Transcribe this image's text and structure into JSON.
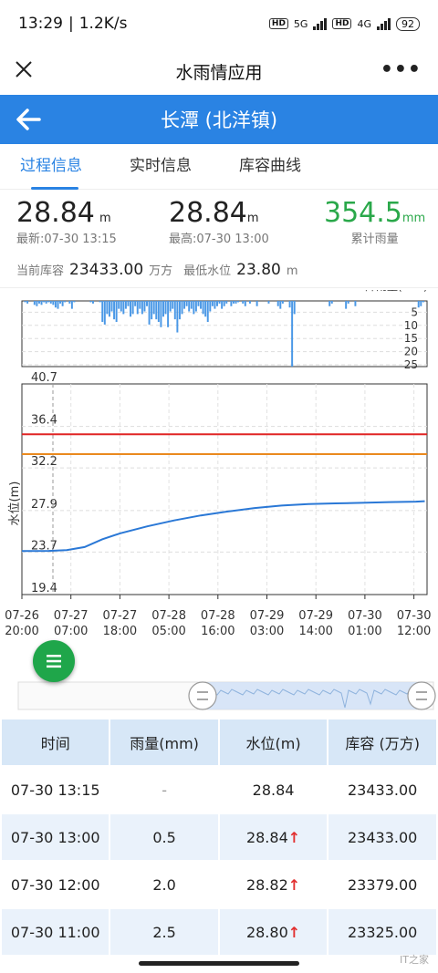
{
  "status_bar": {
    "time": "13:29",
    "speed": "1.2K/s",
    "net1": "5G",
    "net2": "4G",
    "battery": "92"
  },
  "app": {
    "title": "水雨情应用"
  },
  "header": {
    "station": "长潭 (北洋镇)"
  },
  "tabs": [
    {
      "label": "过程信息",
      "active": true
    },
    {
      "label": "实时信息",
      "active": false
    },
    {
      "label": "库容曲线",
      "active": false
    }
  ],
  "stats": {
    "latest_value": "28.84",
    "latest_unit": "m",
    "latest_label": "最新:07-30 13:15",
    "max_value": "28.84",
    "max_unit": "m",
    "max_label": "最高:07-30 13:00",
    "rain_value": "354.5",
    "rain_unit": "mm",
    "rain_label": "累计雨量",
    "storage_label": "当前库容",
    "storage_value": "23433.00",
    "storage_unit": "万方",
    "min_label": "最低水位",
    "min_value": "23.80",
    "min_unit": "m"
  },
  "chart_data": [
    {
      "type": "bar",
      "title": "",
      "ylabel": "降雨量(mm)",
      "ylim": [
        0,
        25
      ],
      "yticks": [
        "5",
        "10",
        "15",
        "20",
        "25"
      ],
      "values": [
        0,
        0.5,
        1,
        0,
        0,
        1.5,
        2,
        1,
        1.5,
        0.5,
        1,
        0.5,
        1,
        1.5,
        2.5,
        3,
        1,
        2,
        0.5,
        0,
        1,
        3,
        0.5,
        0,
        0,
        0,
        0,
        0,
        0,
        0.5,
        1,
        0,
        0,
        0.5,
        8,
        9,
        5,
        6,
        4,
        7,
        8,
        3,
        4,
        5,
        3,
        2,
        6,
        5,
        2,
        5,
        3,
        5,
        4,
        2,
        9,
        7,
        5,
        7,
        8,
        10,
        6,
        5,
        10,
        4,
        3,
        7,
        12,
        7,
        5,
        3,
        2,
        4,
        3,
        5,
        4,
        2,
        3,
        5,
        6,
        8,
        4,
        2,
        3,
        2,
        1,
        3,
        2,
        1,
        0,
        2,
        1,
        1,
        0.5,
        0,
        1,
        2,
        0,
        1,
        0,
        0,
        2,
        0,
        0,
        0,
        0,
        1,
        0,
        0,
        0,
        2,
        3,
        1,
        0,
        0,
        2.5,
        25,
        5,
        0,
        0,
        0,
        0,
        0,
        0,
        0,
        0,
        0,
        0,
        0,
        0,
        0,
        0,
        2,
        1,
        0,
        0,
        0,
        0,
        0,
        3,
        1,
        0,
        0,
        2,
        0,
        0,
        0,
        0,
        0,
        0,
        0,
        0,
        0,
        0,
        0,
        0,
        0,
        0,
        0,
        0,
        0,
        0,
        0,
        0,
        0,
        0,
        0,
        0,
        0,
        0,
        2.5,
        2.0,
        0.5,
        0
      ]
    },
    {
      "type": "line",
      "title": "",
      "ylabel": "水位(m)",
      "ylim": [
        19.4,
        40.7
      ],
      "yticks": [
        "40.7",
        "36.4",
        "32.2",
        "27.9",
        "23.7",
        "19.4"
      ],
      "xticks": [
        "07-26\n20:00",
        "07-27\n07:00",
        "07-27\n18:00",
        "07-28\n05:00",
        "07-28\n16:00",
        "07-29\n03:00",
        "07-29\n14:00",
        "07-30\n01:00",
        "07-30\n12:00"
      ],
      "thresholds": [
        {
          "value": 35.6,
          "color": "#e02424"
        },
        {
          "value": 33.6,
          "color": "#ea8a1e"
        }
      ],
      "series": [
        {
          "color": "#2a78d6",
          "x_hours": [
            0,
            6,
            10,
            14,
            18,
            22,
            28,
            34,
            40,
            46,
            52,
            58,
            64,
            70,
            76,
            82,
            88,
            90
          ],
          "y": [
            23.8,
            23.82,
            23.9,
            24.2,
            25.0,
            25.6,
            26.3,
            26.9,
            27.4,
            27.8,
            28.15,
            28.4,
            28.55,
            28.62,
            28.68,
            28.75,
            28.8,
            28.84
          ]
        }
      ],
      "xrange_hours": [
        0,
        90.5
      ]
    }
  ],
  "table": {
    "headers": [
      "时间",
      "雨量(mm)",
      "水位(m)",
      "库容 (万方)"
    ],
    "rows": [
      {
        "time": "07-30 13:15",
        "rain": "-",
        "level": "28.84",
        "storage": "23433.00",
        "up": false
      },
      {
        "time": "07-30 13:00",
        "rain": "0.5",
        "level": "28.84",
        "storage": "23433.00",
        "up": true
      },
      {
        "time": "07-30 12:00",
        "rain": "2.0",
        "level": "28.82",
        "storage": "23379.00",
        "up": true
      },
      {
        "time": "07-30 11:00",
        "rain": "2.5",
        "level": "28.80",
        "storage": "23325.00",
        "up": true
      }
    ],
    "arrow": "↑"
  }
}
